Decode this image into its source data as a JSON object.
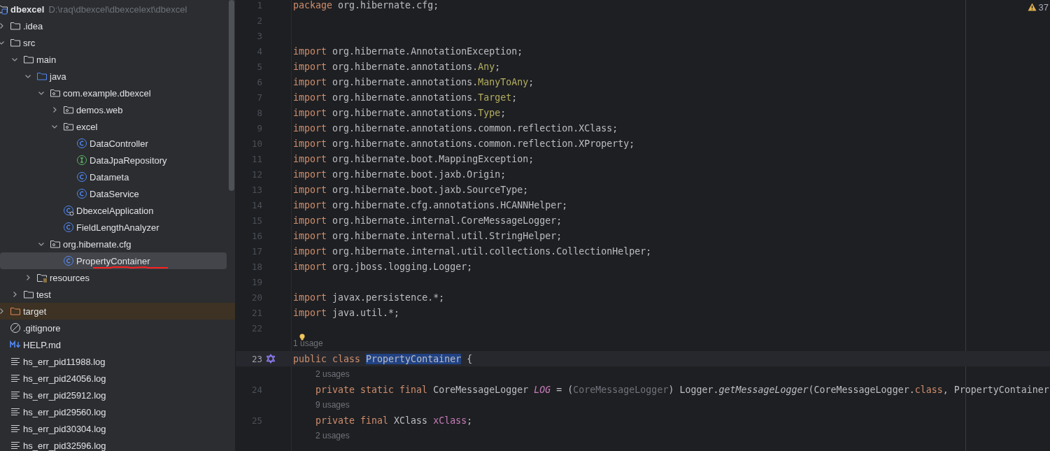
{
  "project_tree": {
    "root": {
      "label": "dbexcel",
      "path": "D:\\raq\\dbexcel\\dbexcelext\\dbexcel",
      "kind": "module",
      "selected": false,
      "children": [
        {
          "label": ".idea",
          "kind": "folder",
          "expanded": false,
          "selected": false
        },
        {
          "label": "src",
          "kind": "folder",
          "expanded": true,
          "selected": false,
          "children": [
            {
              "label": "main",
              "kind": "folder",
              "expanded": true,
              "selected": false,
              "children": [
                {
                  "label": "java",
                  "kind": "source-folder",
                  "expanded": true,
                  "selected": false,
                  "children": [
                    {
                      "label": "com.example.dbexcel",
                      "kind": "package",
                      "expanded": true,
                      "selected": false,
                      "children": [
                        {
                          "label": "demos.web",
                          "kind": "package",
                          "expanded": false,
                          "selected": false
                        },
                        {
                          "label": "excel",
                          "kind": "package",
                          "expanded": true,
                          "selected": false,
                          "children": [
                            {
                              "label": "DataController",
                              "kind": "class",
                              "selected": false
                            },
                            {
                              "label": "DataJpaRepository",
                              "kind": "interface",
                              "selected": false
                            },
                            {
                              "label": "Datameta",
                              "kind": "class",
                              "selected": false
                            },
                            {
                              "label": "DataService",
                              "kind": "class",
                              "selected": false
                            }
                          ]
                        },
                        {
                          "label": "DbexcelApplication",
                          "kind": "app-class",
                          "selected": false
                        },
                        {
                          "label": "FieldLengthAnalyzer",
                          "kind": "class",
                          "selected": false
                        }
                      ]
                    },
                    {
                      "label": "org.hibernate.cfg",
                      "kind": "package",
                      "expanded": true,
                      "selected": false,
                      "children": [
                        {
                          "label": "PropertyContainer",
                          "kind": "class",
                          "selected": true,
                          "underlined": true
                        }
                      ]
                    }
                  ]
                },
                {
                  "label": "resources",
                  "kind": "resources-folder",
                  "expanded": false,
                  "selected": false
                }
              ]
            },
            {
              "label": "test",
              "kind": "folder",
              "expanded": false,
              "selected": false
            }
          ]
        },
        {
          "label": "target",
          "kind": "excluded-folder",
          "expanded": false,
          "selected": false,
          "excluded": true
        },
        {
          "label": ".gitignore",
          "kind": "ignore-file",
          "selected": false
        },
        {
          "label": "HELP.md",
          "kind": "markdown-file",
          "selected": false
        },
        {
          "label": "hs_err_pid11988.log",
          "kind": "log-file",
          "selected": false
        },
        {
          "label": "hs_err_pid24056.log",
          "kind": "log-file",
          "selected": false
        },
        {
          "label": "hs_err_pid25912.log",
          "kind": "log-file",
          "selected": false
        },
        {
          "label": "hs_err_pid29560.log",
          "kind": "log-file",
          "selected": false
        },
        {
          "label": "hs_err_pid30304.log",
          "kind": "log-file",
          "selected": false
        },
        {
          "label": "hs_err_pid32596.log",
          "kind": "log-file",
          "selected": false
        }
      ]
    }
  },
  "editor": {
    "warning_count": "37",
    "lines": [
      {
        "kind": "code",
        "number": "1",
        "current": false,
        "tokens": [
          {
            "kind": "keyword",
            "text": "package"
          },
          {
            "kind": "plain",
            "text": " org.hibernate.cfg;"
          }
        ]
      },
      {
        "kind": "code",
        "number": "2",
        "current": false
      },
      {
        "kind": "code",
        "number": "3",
        "current": false
      },
      {
        "kind": "code",
        "number": "4",
        "current": false,
        "tokens": [
          {
            "kind": "keyword",
            "text": "import"
          },
          {
            "kind": "plain",
            "text": " org.hibernate.AnnotationException;"
          }
        ]
      },
      {
        "kind": "code",
        "number": "5",
        "current": false,
        "tokens": [
          {
            "kind": "keyword",
            "text": "import"
          },
          {
            "kind": "plain",
            "text": " org.hibernate.annotations."
          },
          {
            "kind": "annotation",
            "text": "Any"
          },
          {
            "kind": "plain",
            "text": ";"
          }
        ]
      },
      {
        "kind": "code",
        "number": "6",
        "current": false,
        "tokens": [
          {
            "kind": "keyword",
            "text": "import"
          },
          {
            "kind": "plain",
            "text": " org.hibernate.annotations."
          },
          {
            "kind": "annotation",
            "text": "ManyToAny"
          },
          {
            "kind": "plain",
            "text": ";"
          }
        ]
      },
      {
        "kind": "code",
        "number": "7",
        "current": false,
        "tokens": [
          {
            "kind": "keyword",
            "text": "import"
          },
          {
            "kind": "plain",
            "text": " org.hibernate.annotations."
          },
          {
            "kind": "annotation",
            "text": "Target"
          },
          {
            "kind": "plain",
            "text": ";"
          }
        ]
      },
      {
        "kind": "code",
        "number": "8",
        "current": false,
        "tokens": [
          {
            "kind": "keyword",
            "text": "import"
          },
          {
            "kind": "plain",
            "text": " org.hibernate.annotations."
          },
          {
            "kind": "annotation",
            "text": "Type"
          },
          {
            "kind": "plain",
            "text": ";"
          }
        ]
      },
      {
        "kind": "code",
        "number": "9",
        "current": false,
        "tokens": [
          {
            "kind": "keyword",
            "text": "import"
          },
          {
            "kind": "plain",
            "text": " org.hibernate.annotations.common.reflection.XClass;"
          }
        ]
      },
      {
        "kind": "code",
        "number": "10",
        "current": false,
        "tokens": [
          {
            "kind": "keyword",
            "text": "import"
          },
          {
            "kind": "plain",
            "text": " org.hibernate.annotations.common.reflection.XProperty;"
          }
        ]
      },
      {
        "kind": "code",
        "number": "11",
        "current": false,
        "tokens": [
          {
            "kind": "keyword",
            "text": "import"
          },
          {
            "kind": "plain",
            "text": " org.hibernate.boot.MappingException;"
          }
        ]
      },
      {
        "kind": "code",
        "number": "12",
        "current": false,
        "tokens": [
          {
            "kind": "keyword",
            "text": "import"
          },
          {
            "kind": "plain",
            "text": " org.hibernate.boot.jaxb.Origin;"
          }
        ]
      },
      {
        "kind": "code",
        "number": "13",
        "current": false,
        "tokens": [
          {
            "kind": "keyword",
            "text": "import"
          },
          {
            "kind": "plain",
            "text": " org.hibernate.boot.jaxb.SourceType;"
          }
        ]
      },
      {
        "kind": "code",
        "number": "14",
        "current": false,
        "tokens": [
          {
            "kind": "keyword",
            "text": "import"
          },
          {
            "kind": "plain",
            "text": " org.hibernate.cfg.annotations.HCANNHelper;"
          }
        ]
      },
      {
        "kind": "code",
        "number": "15",
        "current": false,
        "tokens": [
          {
            "kind": "keyword",
            "text": "import"
          },
          {
            "kind": "plain",
            "text": " org.hibernate.internal.CoreMessageLogger;"
          }
        ]
      },
      {
        "kind": "code",
        "number": "16",
        "current": false,
        "tokens": [
          {
            "kind": "keyword",
            "text": "import"
          },
          {
            "kind": "plain",
            "text": " org.hibernate.internal.util.StringHelper;"
          }
        ]
      },
      {
        "kind": "code",
        "number": "17",
        "current": false,
        "tokens": [
          {
            "kind": "keyword",
            "text": "import"
          },
          {
            "kind": "plain",
            "text": " org.hibernate.internal.util.collections.CollectionHelper;"
          }
        ]
      },
      {
        "kind": "code",
        "number": "18",
        "current": false,
        "tokens": [
          {
            "kind": "keyword",
            "text": "import"
          },
          {
            "kind": "plain",
            "text": " org.jboss.logging.Logger;"
          }
        ]
      },
      {
        "kind": "code",
        "number": "19",
        "current": false
      },
      {
        "kind": "code",
        "number": "20",
        "current": false,
        "tokens": [
          {
            "kind": "keyword",
            "text": "import"
          },
          {
            "kind": "plain",
            "text": " javax.persistence.*;"
          }
        ]
      },
      {
        "kind": "code",
        "number": "21",
        "current": false,
        "tokens": [
          {
            "kind": "keyword",
            "text": "import"
          },
          {
            "kind": "plain",
            "text": " java.util.*;"
          }
        ]
      },
      {
        "kind": "code",
        "number": "22",
        "current": false
      },
      {
        "kind": "hint",
        "text": "1 usage",
        "lightbulb": true
      },
      {
        "kind": "code",
        "number": "23",
        "current": true,
        "gutter_mark": true,
        "tokens": [
          {
            "kind": "keyword",
            "text": "public class "
          },
          {
            "kind": "selected",
            "text": "PropertyContainer"
          },
          {
            "kind": "plain",
            "text": " {"
          }
        ],
        "children": [
          {
            "kind": "hint",
            "text": "2 usages",
            "lightbulb": false
          },
          {
            "kind": "code",
            "number": "24",
            "current": false,
            "tokens": [
              {
                "kind": "keyword",
                "text": "private static final "
              },
              {
                "kind": "plain",
                "text": "CoreMessageLogger "
              },
              {
                "kind": "static-field",
                "text": "LOG"
              },
              {
                "kind": "plain",
                "text": " = ("
              },
              {
                "kind": "redundant",
                "text": "CoreMessageLogger"
              },
              {
                "kind": "plain",
                "text": ") Logger."
              },
              {
                "kind": "static-call",
                "text": "getMessageLogger"
              },
              {
                "kind": "plain",
                "text": "(CoreMessageLogger."
              },
              {
                "kind": "keyword",
                "text": "class"
              },
              {
                "kind": "plain",
                "text": ", PropertyContainer"
              }
            ]
          },
          {
            "kind": "hint",
            "text": "9 usages",
            "lightbulb": false
          },
          {
            "kind": "code",
            "number": "25",
            "current": false,
            "tokens": [
              {
                "kind": "keyword",
                "text": "private final "
              },
              {
                "kind": "plain",
                "text": "XClass "
              },
              {
                "kind": "field",
                "text": "xClass"
              },
              {
                "kind": "plain",
                "text": ";"
              }
            ]
          },
          {
            "kind": "hint",
            "text": "2 usages",
            "lightbulb": false
          }
        ]
      }
    ]
  }
}
